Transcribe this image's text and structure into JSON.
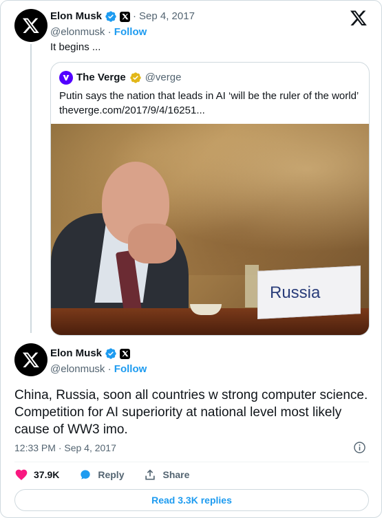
{
  "parent_tweet": {
    "author_name": "Elon Musk",
    "dot": "·",
    "date": "Sep 4, 2017",
    "handle": "@elonmusk",
    "separator": "·",
    "follow_label": "Follow",
    "text": "It begins ..."
  },
  "quoted_tweet": {
    "author_name": "The Verge",
    "handle": "@verge",
    "text": "Putin says the nation that leads in AI ‘will be the ruler of the world’ theverge.com/2017/9/4/16251...",
    "image": {
      "placard_text": "Russia"
    }
  },
  "main_tweet": {
    "author_name": "Elon Musk",
    "handle": "@elonmusk",
    "separator": "·",
    "follow_label": "Follow",
    "text": "China, Russia, soon all countries w strong computer science. Competition for AI superiority at national level most likely cause of WW3 imo.",
    "timestamp": "12:33 PM · Sep 4, 2017"
  },
  "actions": {
    "likes": "37.9K",
    "reply_label": "Reply",
    "share_label": "Share"
  },
  "read_replies_label": "Read 3.3K replies",
  "colors": {
    "accent": "#1d9bf0",
    "like": "#f91880",
    "verge": "#5200ff",
    "gold_badge": "#e2b719"
  },
  "icons": [
    "x-logo-icon",
    "verified-badge-icon",
    "x-affiliate-badge-icon",
    "gold-verified-badge-icon",
    "info-icon",
    "heart-icon",
    "reply-icon",
    "share-icon"
  ]
}
